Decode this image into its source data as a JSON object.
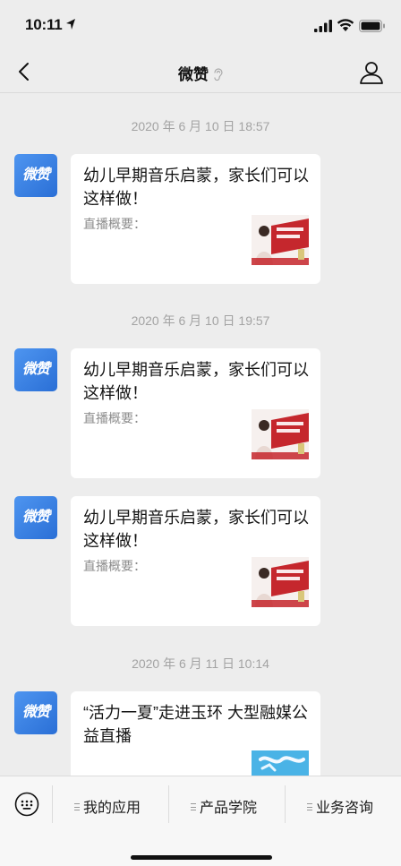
{
  "status": {
    "time": "10:11"
  },
  "nav": {
    "title": "微赞"
  },
  "messages": [
    {
      "timestamp": "2020 年 6 月 10 日 18:57",
      "avatar": "微赞",
      "title": "幼儿早期音乐启蒙，家长们可以这样做！",
      "desc": "直播概要："
    },
    {
      "timestamp": "2020 年 6 月 10 日 19:57",
      "avatar": "微赞",
      "title": "幼儿早期音乐启蒙，家长们可以这样做！",
      "desc": "直播概要："
    },
    {
      "avatar": "微赞",
      "title": "幼儿早期音乐启蒙，家长们可以这样做！",
      "desc": "直播概要："
    },
    {
      "timestamp": "2020 年 6 月 11 日 10:14",
      "avatar": "微赞",
      "title": "“活力一夏”走进玉环 大型融媒公益直播"
    }
  ],
  "menu": {
    "items": [
      "我的应用",
      "产品学院",
      "业务咨询"
    ]
  },
  "colors": {
    "background": "#ededed",
    "brand_blue": "#2a6fd6",
    "timestamp": "#a3a3a3"
  }
}
